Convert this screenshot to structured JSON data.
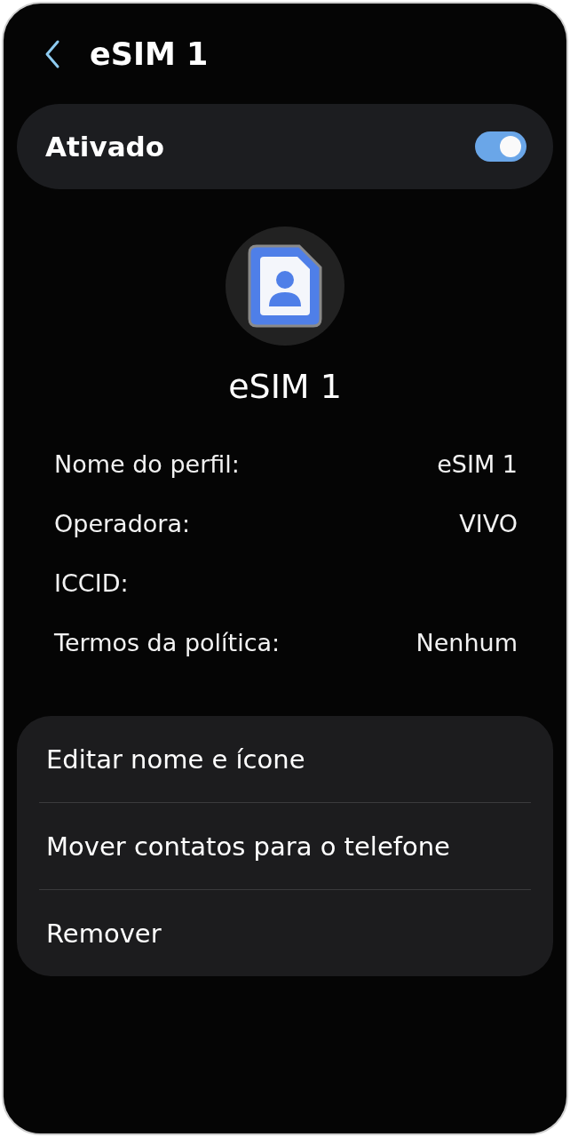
{
  "header": {
    "title": "eSIM 1"
  },
  "toggle": {
    "label": "Ativado",
    "on": true
  },
  "profile": {
    "name": "eSIM 1"
  },
  "details": [
    {
      "label": "Nome do perfil:",
      "value": "eSIM 1"
    },
    {
      "label": "Operadora:",
      "value": "VIVO"
    },
    {
      "label": "ICCID:"
    },
    {
      "label": "Termos da política:",
      "value": "Nenhum"
    }
  ],
  "actions": [
    "Editar nome e ícone",
    "Mover contatos para o telefone",
    "Remover"
  ]
}
